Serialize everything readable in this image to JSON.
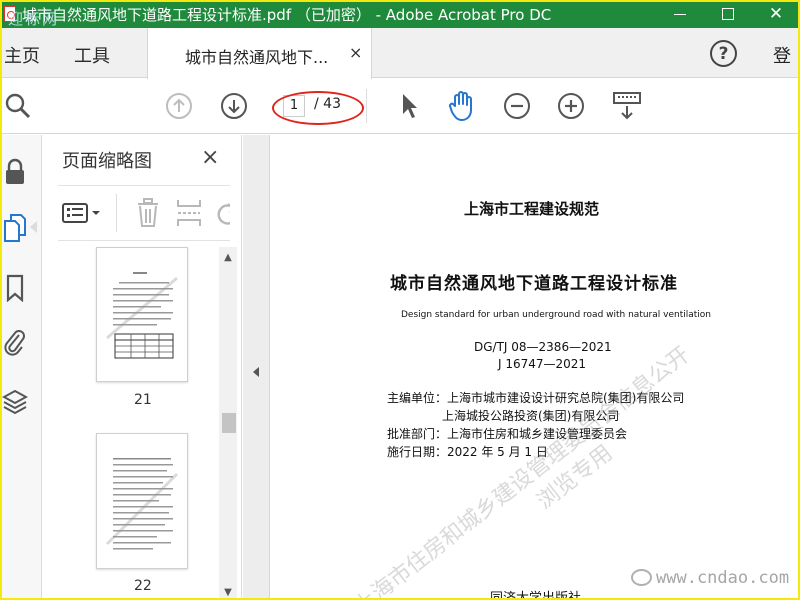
{
  "window": {
    "title": "城市自然通风地下道路工程设计标准.pdf （已加密） - Adobe Acrobat Pro DC",
    "watermark_top_left": "迎标网"
  },
  "tabs": {
    "home": "主页",
    "tools": "工具",
    "document": "城市自然通风地下...",
    "close": "×",
    "help": "?",
    "signin": "登"
  },
  "toolbar": {
    "current_page": "1",
    "total_pages": "/ 43",
    "icons": [
      "search-icon",
      "page-up-icon",
      "page-down-icon",
      "select-cursor-icon",
      "hand-tool-icon",
      "zoom-out-icon",
      "zoom-in-icon",
      "scrolling-mode-icon"
    ]
  },
  "colors": {
    "titlebar": "#1f8a3c",
    "accent_blue": "#2776d0",
    "annotation_red": "#e0261b",
    "frame_yellow": "#f5e90a"
  },
  "panel": {
    "title": "页面缩略图",
    "close": "×",
    "thumbnails": [
      {
        "label": "21"
      },
      {
        "label": "22"
      }
    ]
  },
  "document": {
    "lines": [
      "上海市工程建设规范",
      "城市自然通风地下道路工程设计标准",
      "Design standard for urban underground road with natural ventilation",
      "DG/TJ 08—2386—2021",
      "J 16747—2021",
      "主编单位：上海市城市建设设计研究总院(集团)有限公司",
      "上海城投公路投资(集团)有限公司",
      "批准部门：上海市住房和城乡建设管理委员会",
      "施行日期：2022 年 5 月 1 日",
      "同济大学出版社"
    ],
    "watermarks": [
      "上海市住房和城乡建设管理委员会信息公开",
      "浏览专用"
    ],
    "site_watermark": "www.cndao.com"
  }
}
